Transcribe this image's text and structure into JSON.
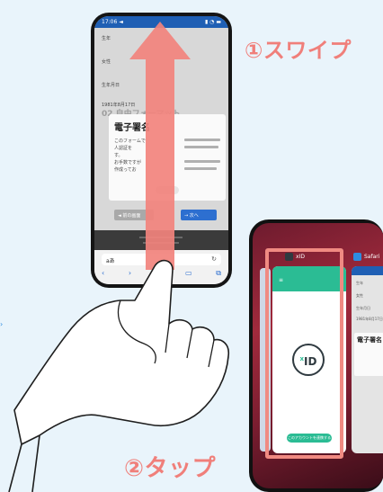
{
  "callouts": {
    "step1": "①スワイプ",
    "step2": "②タップ"
  },
  "phone1": {
    "status_time": "17:06 ◄",
    "status_icons": "▮ ◔ ▬",
    "form_rows": [
      "生年",
      "女性",
      "生年月日",
      "1981年8月17日"
    ],
    "heading": "02 自由フォーマット",
    "dialog": {
      "title": "電子署名",
      "lines": [
        "このフォームで",
        "人認証を",
        "す。",
        "お手数ですが",
        "作成ってお"
      ]
    },
    "nav_back": "◄ 前の画面",
    "nav_next": "→ 次へ",
    "url_text": "aあ",
    "toolbar_icons": [
      "‹",
      "›",
      "⇧",
      "▭",
      "⧉"
    ]
  },
  "phone2": {
    "app_label_xid": "xID",
    "app_label_safari": "Safari",
    "logo_text": "ID",
    "logo_prefix": "x",
    "card_button": "このアカウントを連携する",
    "back_rows": [
      "生年",
      "女性",
      "生年月日",
      "1981年8月17日"
    ],
    "back_dialog_title": "電子署名"
  },
  "colors": {
    "accent": "#f07f7a",
    "xid_green": "#2bbc94",
    "safari_blue": "#2d8de0"
  }
}
